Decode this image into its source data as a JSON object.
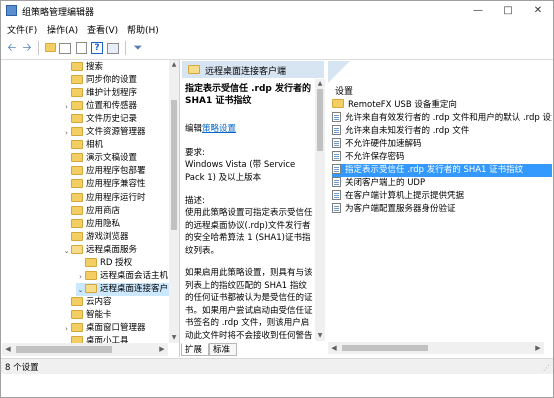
{
  "window": {
    "title": "组策略管理编辑器"
  },
  "menu": {
    "items": [
      "文件(F)",
      "操作(A)",
      "查看(V)",
      "帮助(H)"
    ]
  },
  "tree": {
    "items": [
      {
        "label": "搜索",
        "indent": 0,
        "twisty": ""
      },
      {
        "label": "同步你的设置",
        "indent": 0,
        "twisty": ""
      },
      {
        "label": "维护计划程序",
        "indent": 0,
        "twisty": ""
      },
      {
        "label": "位置和传感器",
        "indent": 0,
        "twisty": "›"
      },
      {
        "label": "文件历史记录",
        "indent": 0,
        "twisty": ""
      },
      {
        "label": "文件资源管理器",
        "indent": 0,
        "twisty": "›"
      },
      {
        "label": "相机",
        "indent": 0,
        "twisty": ""
      },
      {
        "label": "演示文稿设置",
        "indent": 0,
        "twisty": ""
      },
      {
        "label": "应用程序包部署",
        "indent": 0,
        "twisty": ""
      },
      {
        "label": "应用程序兼容性",
        "indent": 0,
        "twisty": ""
      },
      {
        "label": "应用程序运行时",
        "indent": 0,
        "twisty": ""
      },
      {
        "label": "应用商店",
        "indent": 0,
        "twisty": ""
      },
      {
        "label": "应用隐私",
        "indent": 0,
        "twisty": ""
      },
      {
        "label": "游戏浏览器",
        "indent": 0,
        "twisty": ""
      },
      {
        "label": "远程桌面服务",
        "indent": 0,
        "twisty": "⌄"
      },
      {
        "label": "RD 授权",
        "indent": 1,
        "twisty": ""
      },
      {
        "label": "远程桌面会话主机",
        "indent": 1,
        "twisty": "›"
      },
      {
        "label": "远程桌面连接客户",
        "indent": 1,
        "twisty": "⌄",
        "selected": true
      },
      {
        "label": "云内容",
        "indent": 0,
        "twisty": ""
      },
      {
        "label": "智能卡",
        "indent": 0,
        "twisty": ""
      },
      {
        "label": "桌面窗口管理器",
        "indent": 0,
        "twisty": "›"
      },
      {
        "label": "桌面小工具",
        "indent": 0,
        "twisty": ""
      }
    ]
  },
  "header": {
    "crumb": "远程桌面连接客户端"
  },
  "description": {
    "title": "指定表示受信任 .rdp 发行者的 SHA1 证书指纹",
    "edit_prefix": "编辑",
    "edit_link": "策略设置",
    "req_label": "要求:",
    "req_text": "Windows Vista (带 Service Pack 1) 及以上版本",
    "desc_label": "描述:",
    "para1": "使用此策略设置可指定表示受信任的远程桌面协议(.rdp)文件发行者的安全哈希算法 1 (SHA1)证书指纹列表。",
    "para2": "如果启用此策略设置，则具有与该列表上的指纹匹配的 SHA1 指纹的任何证书都被认为是受信任的证书。如果用户尝试启动由受信任证书签名的 .rdp 文件，则该用户启动此文件时将不会接收到任何警告消息。若要获得指纹，请查看证书的详细信息，然后单击\"指纹\"字段。"
  },
  "list": {
    "header": "设置",
    "items": [
      {
        "type": "folder",
        "label": "RemoteFX USB 设备重定向"
      },
      {
        "type": "policy",
        "label": "允许来自有效发行者的 .rdp 文件和用户的默认 .rdp 设置"
      },
      {
        "type": "policy",
        "label": "允许来自未知发行者的 .rdp 文件"
      },
      {
        "type": "policy",
        "label": "不允许硬件加速解码"
      },
      {
        "type": "policy",
        "label": "不允许保存密码"
      },
      {
        "type": "policy",
        "label": "指定表示受信任 .rdp 发行者的 SHA1 证书指纹",
        "selected": true
      },
      {
        "type": "policy",
        "label": "关闭客户端上的 UDP"
      },
      {
        "type": "policy",
        "label": "在客户端计算机上提示提供凭据"
      },
      {
        "type": "policy",
        "label": "为客户端配置服务器身份验证"
      }
    ]
  },
  "tabs": [
    "扩展",
    "标准"
  ],
  "status": {
    "text": "8 个设置"
  }
}
